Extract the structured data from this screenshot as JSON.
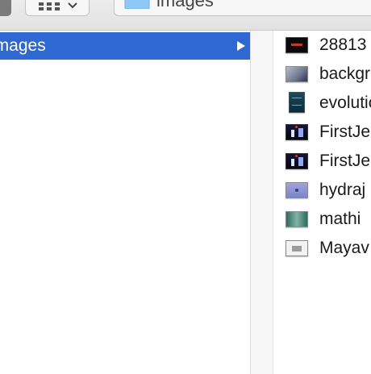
{
  "toolbar": {
    "path_label": "images"
  },
  "column1": {
    "selected_item": "images"
  },
  "column2": {
    "files": [
      {
        "name": "28813",
        "thumb": "black"
      },
      {
        "name": "backgr",
        "thumb": "gray"
      },
      {
        "name": "evolutio",
        "thumb": "teal"
      },
      {
        "name": "FirstJe",
        "thumb": "stage"
      },
      {
        "name": "FirstJe",
        "thumb": "stage"
      },
      {
        "name": "hydraj",
        "thumb": "purple"
      },
      {
        "name": "mathi",
        "thumb": "green"
      },
      {
        "name": "Mayav",
        "thumb": "light"
      }
    ]
  },
  "colors": {
    "selection": "#2e69d3",
    "folder": "#8ec9f5"
  }
}
